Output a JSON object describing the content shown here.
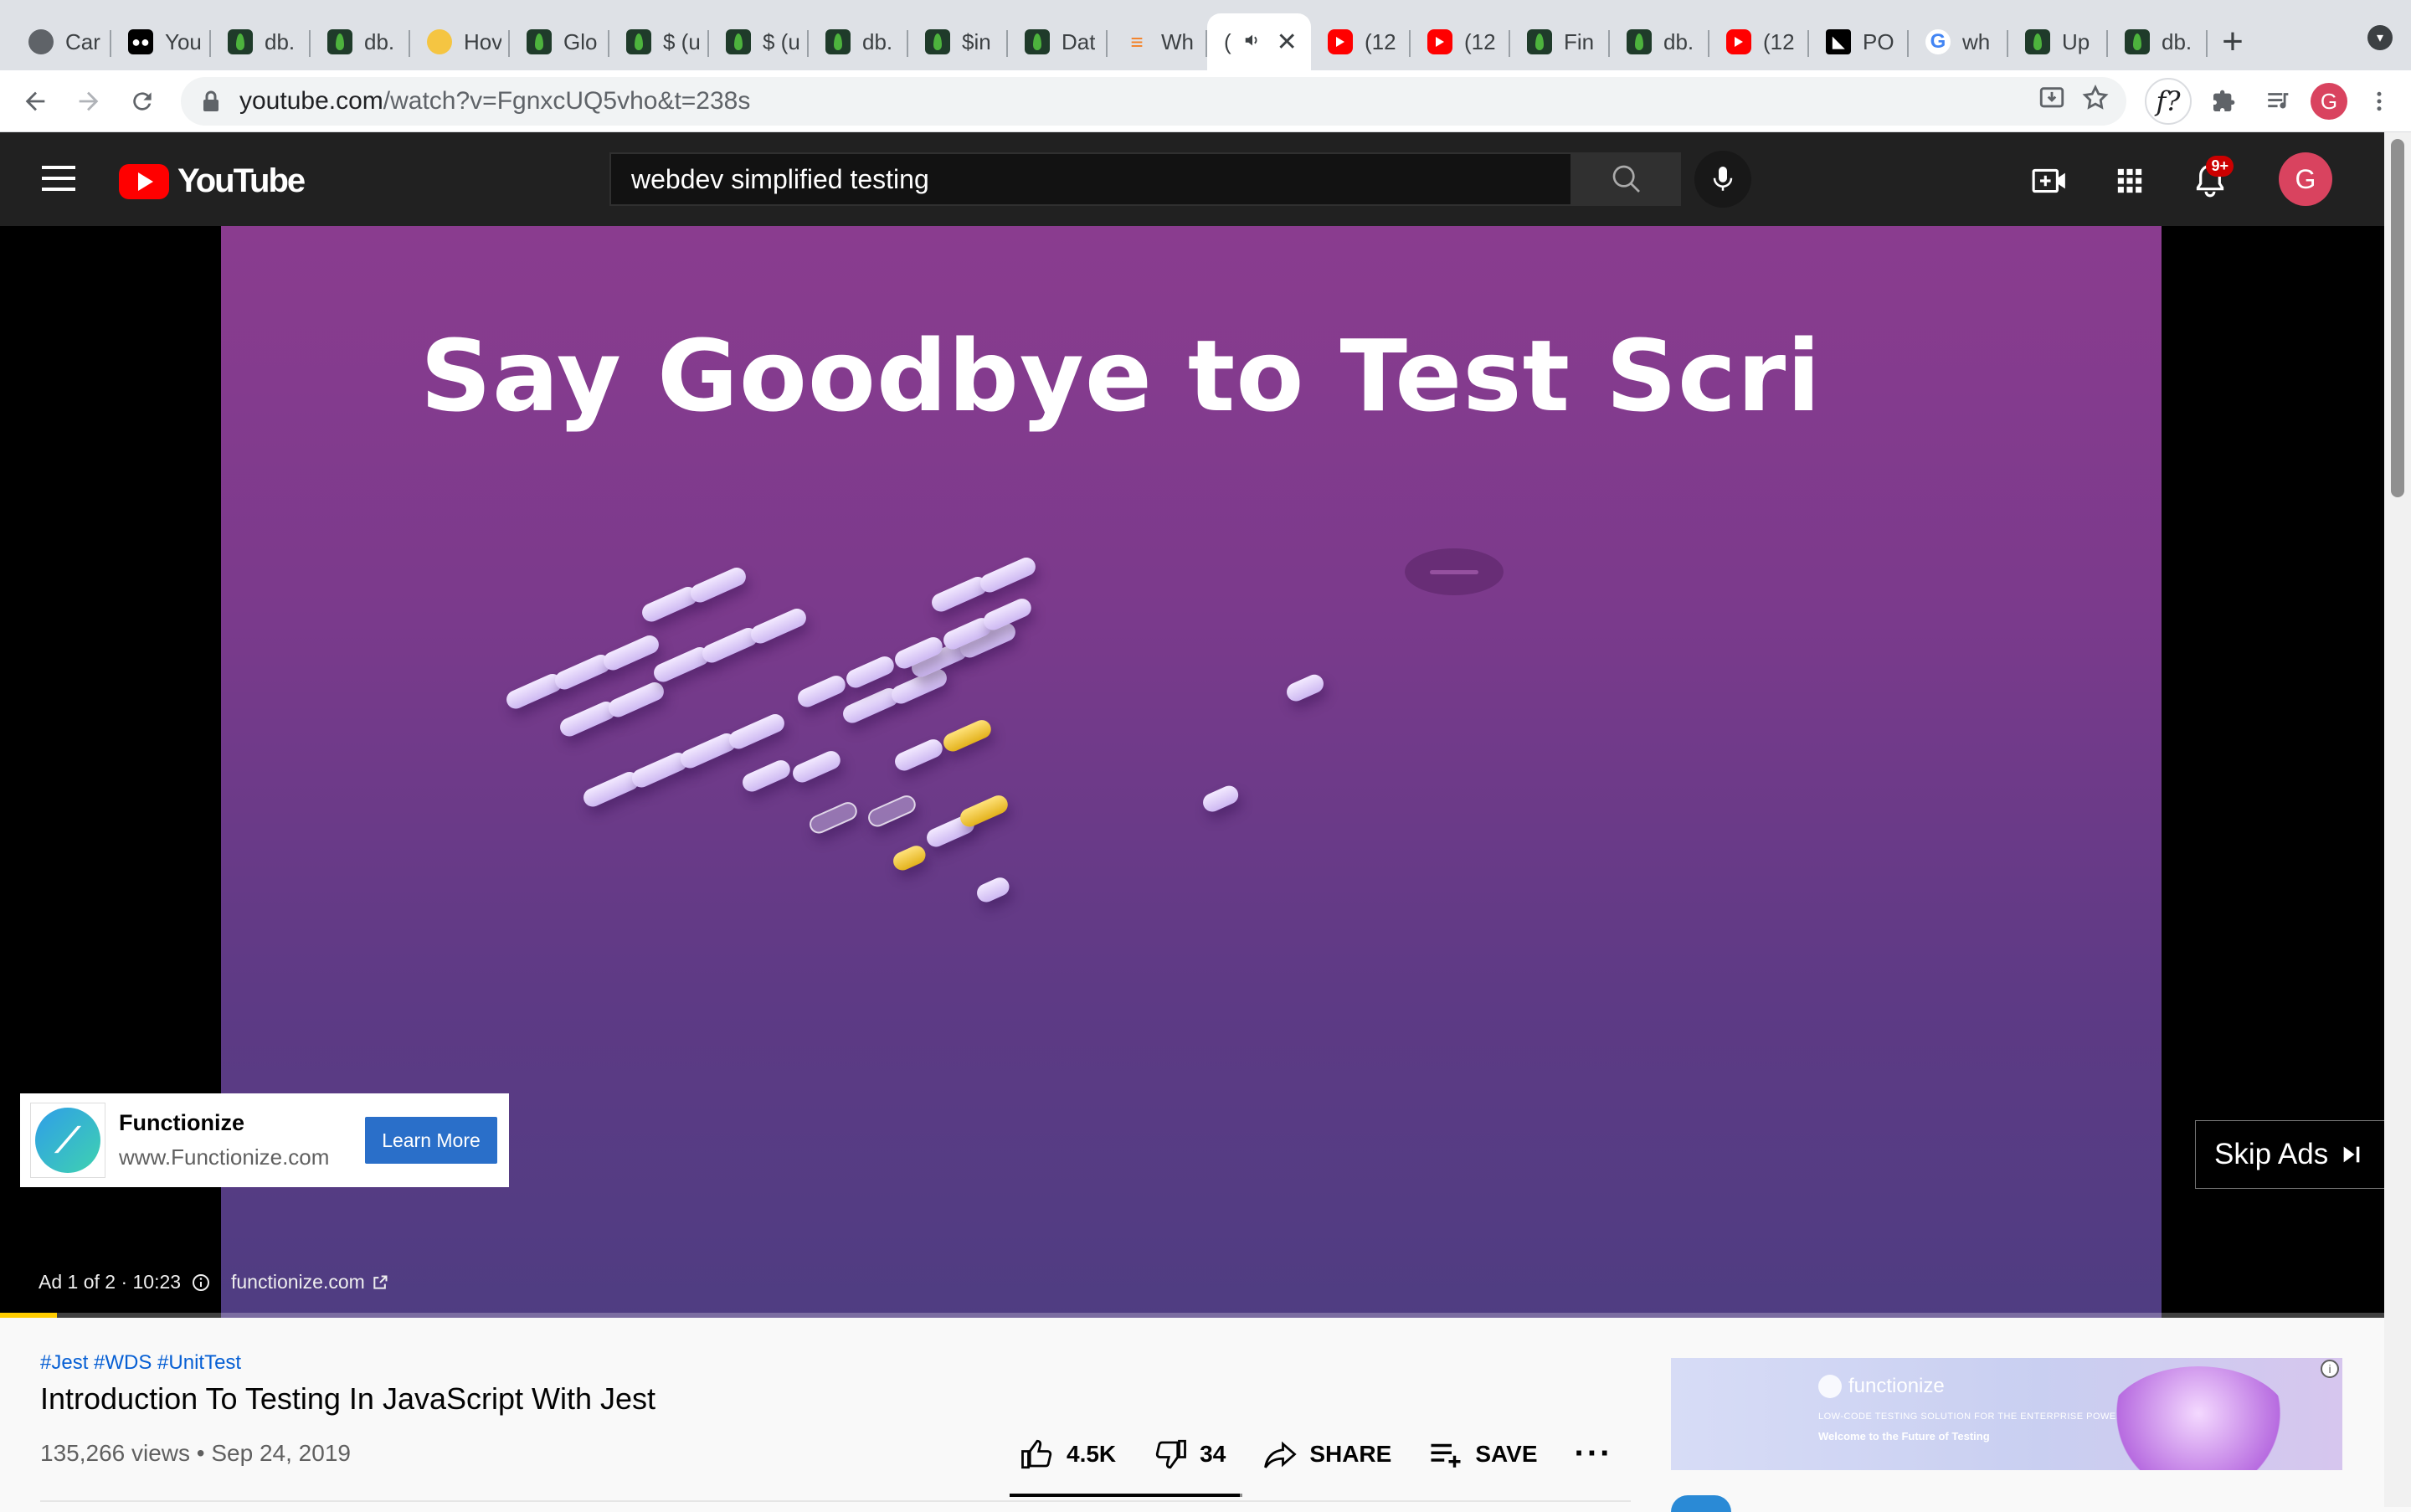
{
  "browser": {
    "tabs": [
      {
        "title": "Car",
        "icon": "globe-icon"
      },
      {
        "title": "You",
        "icon": "medium-icon"
      },
      {
        "title": "db.",
        "icon": "mongodb-leaf-icon"
      },
      {
        "title": "db.",
        "icon": "mongodb-leaf-icon"
      },
      {
        "title": "Hov",
        "icon": "dog-icon"
      },
      {
        "title": "Glo",
        "icon": "mongodb-leaf-icon"
      },
      {
        "title": "$ (u",
        "icon": "mongodb-leaf-icon"
      },
      {
        "title": "$ (u",
        "icon": "mongodb-leaf-icon"
      },
      {
        "title": "db.",
        "icon": "mongodb-leaf-icon"
      },
      {
        "title": "$in",
        "icon": "mongodb-leaf-icon"
      },
      {
        "title": "Dat",
        "icon": "leaf-icon"
      },
      {
        "title": "Wh",
        "icon": "stackoverflow-icon"
      },
      {
        "title": "(",
        "icon": "speaker-icon",
        "active": true
      },
      {
        "title": "(12",
        "icon": "youtube-icon"
      },
      {
        "title": "(12",
        "icon": "youtube-icon"
      },
      {
        "title": "Fin",
        "icon": "mongodb-leaf-icon"
      },
      {
        "title": "db.",
        "icon": "mongodb-leaf-icon"
      },
      {
        "title": "(12",
        "icon": "youtube-icon"
      },
      {
        "title": "PO",
        "icon": "postman-icon"
      },
      {
        "title": "wh",
        "icon": "google-icon"
      },
      {
        "title": "Up",
        "icon": "mongodb-leaf-icon"
      },
      {
        "title": "db.",
        "icon": "mongodb-leaf-icon"
      }
    ],
    "new_tab": "+",
    "url_host": "youtube.com",
    "url_path": "/watch?v=FgnxcUQ5vho&t=238s",
    "ext_f": "f?",
    "profile_initial": "G"
  },
  "youtube": {
    "logo_text": "YouTube",
    "search_value": "webdev simplified testing",
    "notifications_badge": "9+",
    "avatar_initial": "G"
  },
  "player": {
    "video_text": "Say Goodbye to Test Scri",
    "ad": {
      "advertiser": "Functionize",
      "advertiser_url": "www.Functionize.com",
      "cta": "Learn More",
      "skip_label": "Skip Ads",
      "info": "Ad 1 of 2 · 10:23",
      "site": "functionize.com"
    },
    "progress": 0.024
  },
  "video": {
    "hashtags": "#Jest #WDS #UnitTest",
    "title": "Introduction To Testing In JavaScript With Jest",
    "views_date": "135,266 views • Sep 24, 2019",
    "likes": "4.5K",
    "dislikes": "34",
    "share": "SHARE",
    "save": "SAVE",
    "like_ratio": 0.99
  },
  "side_ad": {
    "brand": "functionize",
    "tagline": "LOW-CODE TESTING SOLUTION FOR THE ENTERPRISE POWERED BY AI",
    "sub": "Welcome to the Future of Testing"
  },
  "colors": {
    "youtube_red": "#ff0000",
    "link_blue": "#065fd4",
    "ad_progress": "#ffcc00",
    "cta_blue": "#2a6fc9"
  }
}
